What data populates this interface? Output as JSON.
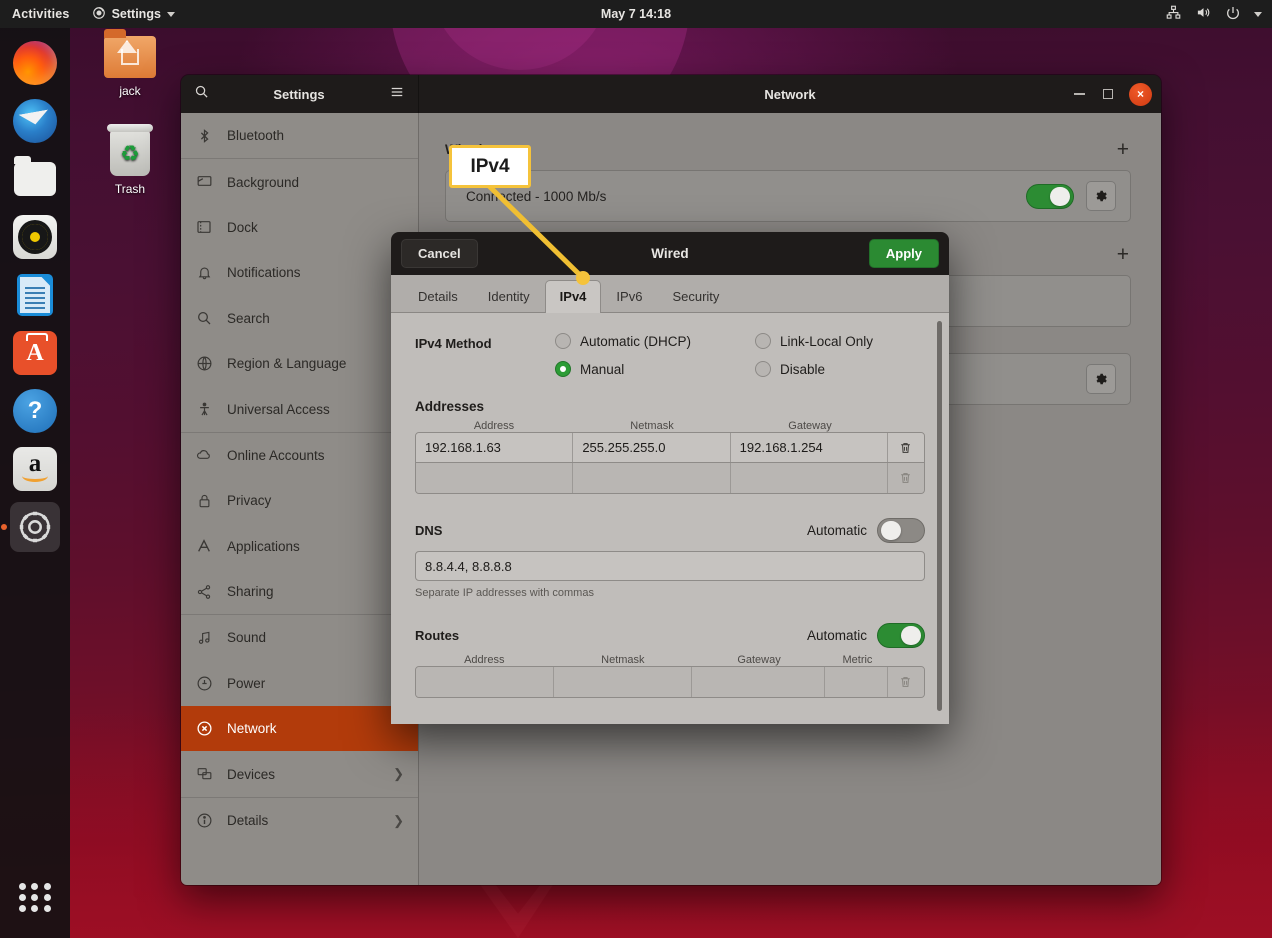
{
  "topbar": {
    "activities": "Activities",
    "app_menu": "Settings",
    "app_icon": "settings-gear-icon",
    "clock": "May 7  14:18",
    "status_icons": [
      "network-wired-icon",
      "volume-icon",
      "power-icon",
      "caret-down-icon"
    ]
  },
  "dock": {
    "items": [
      {
        "name": "firefox",
        "label": "Firefox",
        "active": false
      },
      {
        "name": "thunderbird",
        "label": "Thunderbird",
        "active": false
      },
      {
        "name": "files",
        "label": "Files",
        "active": false
      },
      {
        "name": "rhythmbox",
        "label": "Rhythmbox",
        "active": false
      },
      {
        "name": "libreoffice-writer",
        "label": "LibreOffice Writer",
        "active": false
      },
      {
        "name": "ubuntu-software",
        "label": "Ubuntu Software",
        "glyph": "A",
        "active": false
      },
      {
        "name": "help",
        "label": "Help",
        "glyph": "?",
        "active": false
      },
      {
        "name": "amazon",
        "label": "Amazon",
        "glyph": "a",
        "active": false
      },
      {
        "name": "settings",
        "label": "Settings",
        "active": true
      }
    ],
    "show_apps_label": "Show Applications"
  },
  "desktop": {
    "icons": [
      {
        "name": "home-folder",
        "label": "jack"
      },
      {
        "name": "trash",
        "label": "Trash"
      }
    ]
  },
  "settings_window": {
    "sidebar_title": "Settings",
    "search_icon": "search-icon",
    "menu_icon": "hamburger-menu-icon",
    "window_title": "Network",
    "window_buttons": {
      "minimize": "—",
      "maximize": "□",
      "close": "×"
    },
    "sidebar_items": [
      {
        "label": "Bluetooth",
        "icon": "bluetooth-icon",
        "selected": false,
        "submenu": false,
        "sep_after": true
      },
      {
        "label": "Background",
        "icon": "monitor-icon",
        "selected": false,
        "submenu": false
      },
      {
        "label": "Dock",
        "icon": "dock-icon",
        "selected": false,
        "submenu": false
      },
      {
        "label": "Notifications",
        "icon": "bell-icon",
        "selected": false,
        "submenu": false
      },
      {
        "label": "Search",
        "icon": "search-icon",
        "selected": false,
        "submenu": false
      },
      {
        "label": "Region & Language",
        "icon": "globe-icon",
        "selected": false,
        "submenu": false
      },
      {
        "label": "Universal Access",
        "icon": "accessibility-icon",
        "selected": false,
        "submenu": false,
        "sep_after": true
      },
      {
        "label": "Online Accounts",
        "icon": "cloud-icon",
        "selected": false,
        "submenu": false
      },
      {
        "label": "Privacy",
        "icon": "lock-icon",
        "selected": false,
        "submenu": false
      },
      {
        "label": "Applications",
        "icon": "applications-icon",
        "selected": false,
        "submenu": false
      },
      {
        "label": "Sharing",
        "icon": "share-icon",
        "selected": false,
        "submenu": false,
        "sep_after": true
      },
      {
        "label": "Sound",
        "icon": "music-note-icon",
        "selected": false,
        "submenu": false
      },
      {
        "label": "Power",
        "icon": "power-circle-icon",
        "selected": false,
        "submenu": false
      },
      {
        "label": "Network",
        "icon": "network-icon",
        "selected": true,
        "submenu": false
      },
      {
        "label": "Devices",
        "icon": "devices-icon",
        "selected": false,
        "submenu": true
      },
      {
        "label": "Details",
        "icon": "info-icon",
        "selected": false,
        "submenu": true
      }
    ]
  },
  "network_panel": {
    "groups": [
      {
        "title": "Wired",
        "add_icon": "plus-icon",
        "rows": [
          {
            "label": "Connected - 1000 Mb/s",
            "toggle": "on",
            "gear_icon": "gear-icon"
          }
        ]
      },
      {
        "title": "",
        "add_icon": "plus-icon",
        "rows": [
          {
            "label": "",
            "toggle": null,
            "gear_icon": "gear-icon"
          }
        ]
      }
    ]
  },
  "wired_dialog": {
    "cancel_label": "Cancel",
    "title": "Wired",
    "apply_label": "Apply",
    "tabs": [
      {
        "label": "Details",
        "active": false
      },
      {
        "label": "Identity",
        "active": false
      },
      {
        "label": "IPv4",
        "active": true
      },
      {
        "label": "IPv6",
        "active": false
      },
      {
        "label": "Security",
        "active": false
      }
    ],
    "method": {
      "label": "IPv4 Method",
      "options": [
        {
          "label": "Automatic (DHCP)",
          "selected": false
        },
        {
          "label": "Manual",
          "selected": true
        },
        {
          "label": "Link-Local Only",
          "selected": false
        },
        {
          "label": "Disable",
          "selected": false
        }
      ]
    },
    "addresses": {
      "title": "Addresses",
      "columns": [
        "Address",
        "Netmask",
        "Gateway"
      ],
      "delete_icon": "trash-icon",
      "rows": [
        {
          "address": "192.168.1.63",
          "netmask": "255.255.255.0",
          "gateway": "192.168.1.254"
        },
        {
          "address": "",
          "netmask": "",
          "gateway": ""
        }
      ]
    },
    "dns": {
      "title": "DNS",
      "automatic_label": "Automatic",
      "automatic": "off",
      "value": "8.8.4.4, 8.8.8.8",
      "hint": "Separate IP addresses with commas"
    },
    "routes": {
      "title": "Routes",
      "automatic_label": "Automatic",
      "automatic": "on",
      "columns": [
        "Address",
        "Netmask",
        "Gateway",
        "Metric"
      ],
      "delete_icon": "trash-icon",
      "rows": [
        {
          "address": "",
          "netmask": "",
          "gateway": "",
          "metric": ""
        }
      ]
    }
  },
  "annotation": {
    "callout_text": "IPv4",
    "border_color": "#f5c33b",
    "line_color": "#f0bf33"
  },
  "colors": {
    "accent_orange": "#b23b0b",
    "green_toggle": "#2c8c33",
    "sidebar_bg": "#8f8c88",
    "dialog_bg": "#c0bdba",
    "header_dark": "#1e1b1a"
  }
}
